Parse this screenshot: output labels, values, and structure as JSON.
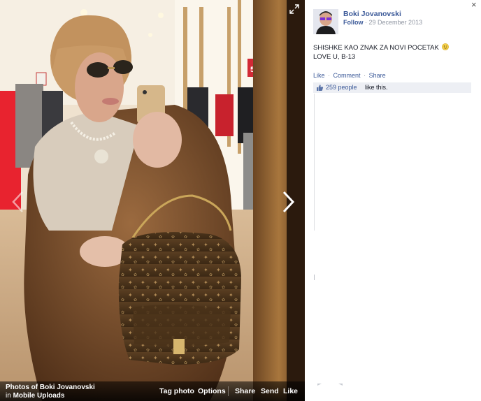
{
  "viewer": {
    "album_owner_line": "Photos of Boki Jovanovski",
    "album_prefix": "in",
    "album_name": "Mobile Uploads",
    "actions": [
      {
        "label": "Tag photo",
        "name": "tag-photo-button"
      },
      {
        "label": "Options",
        "name": "options-button"
      },
      {
        "label": "Share",
        "name": "share-button"
      },
      {
        "label": "Send",
        "name": "send-button"
      },
      {
        "label": "Like",
        "name": "like-photo-button"
      }
    ],
    "icons": {
      "prev": "chevron-left-icon",
      "next": "chevron-right-icon",
      "expand": "fullscreen-icon"
    }
  },
  "post": {
    "author": "Boki Jovanovski",
    "follow_label": "Follow",
    "separator": "·",
    "date": "29 December 2013",
    "caption_line1": "SHISHKE KAO ZNAK ZA NOVI POCETAK",
    "caption_line2": "LOVE U, B-13",
    "caption_emoji": "wink-smiley-icon",
    "action_like": "Like",
    "action_comment": "Comment",
    "action_share": "Share",
    "likes_count": "259 people",
    "likes_suffix": "like this.",
    "close_label": "×"
  },
  "colors": {
    "link_blue": "#3b5998",
    "meta_grey": "#9197a3",
    "likes_bg": "#edeff4",
    "text": "#141823"
  }
}
